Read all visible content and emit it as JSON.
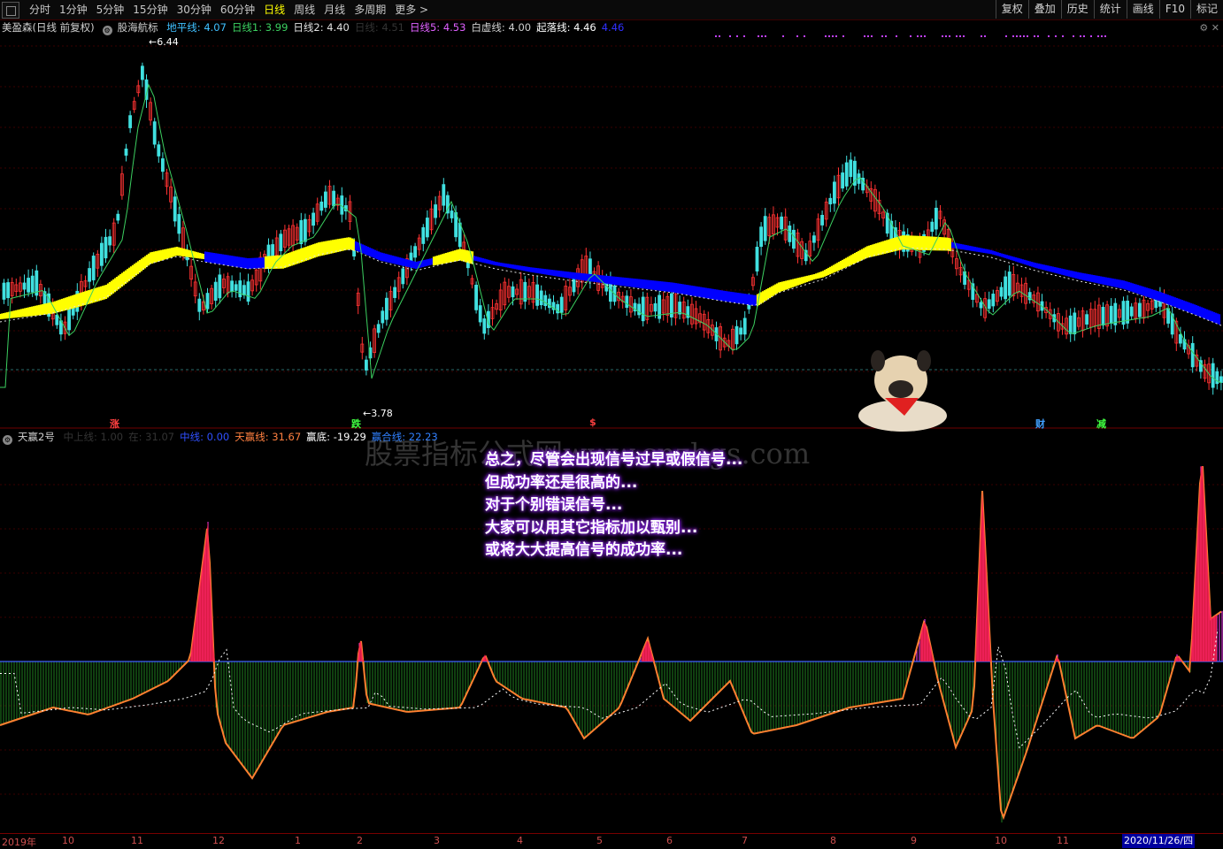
{
  "toolbar": {
    "tabs": [
      "分时",
      "1分钟",
      "5分钟",
      "15分钟",
      "30分钟",
      "60分钟",
      "日线",
      "周线",
      "月线",
      "多周期",
      "更多 >"
    ],
    "active": "日线",
    "right_buttons": [
      "复权",
      "叠加",
      "历史",
      "统计",
      "画线",
      "F10",
      "标记"
    ]
  },
  "main_legend": {
    "stock": "美盈森(日线 前复权)",
    "indicator": "股海航标",
    "items": [
      {
        "label": "地平线",
        "value": "4.07",
        "color": "#40c0ff"
      },
      {
        "label": "日线1",
        "value": "3.99",
        "color": "#3cd060"
      },
      {
        "label": "日线2",
        "value": "4.40",
        "color": "#e0e0e0"
      },
      {
        "label": "日线",
        "value": "4.51",
        "color": "#333333"
      },
      {
        "label": "日线5",
        "value": "4.53",
        "color": "#e060ff"
      },
      {
        "label": "白虚线",
        "value": "4.00",
        "color": "#d0d0d0"
      },
      {
        "label": "起落线",
        "value": "4.46",
        "color": "#ffffff"
      },
      {
        "label": "",
        "value": "4.46",
        "color": "#3030ff"
      }
    ]
  },
  "price_labels": {
    "high": "6.44",
    "low": "3.78"
  },
  "signals": [
    {
      "text": "涨",
      "color": "#ff4040"
    },
    {
      "text": "跌",
      "color": "#40ff40"
    },
    {
      "text": "$",
      "color": "#ff4040"
    },
    {
      "text": "财",
      "color": "#40a0ff"
    },
    {
      "text": "减",
      "color": "#40ff40"
    }
  ],
  "sub_legend": {
    "name": "天赢2号",
    "items": [
      {
        "label": "中上线",
        "value": "1.00",
        "color": "#333333"
      },
      {
        "label": "在",
        "value": "31.07",
        "color": "#333333"
      },
      {
        "label": "中线",
        "value": "0.00",
        "color": "#3050ff"
      },
      {
        "label": "天赢线",
        "value": "31.67",
        "color": "#ff8040"
      },
      {
        "label": "赢底",
        "value": "-19.29",
        "color": "#ffffff"
      },
      {
        "label": "赢合线",
        "value": "22.23",
        "color": "#3080ff"
      }
    ]
  },
  "watermark": "股票指标公式网www.cnzhgs.com",
  "annotation_lines": [
    "总之，尽管会出现信号过早或假信号...",
    "但成功率还是很高的...",
    "对于个别错误信号...",
    "大家可以用其它指标加以甄别...",
    "或将大大提高信号的成功率..."
  ],
  "date_axis": {
    "labels": [
      "2019年",
      "10",
      "11",
      "12",
      "1",
      "2",
      "3",
      "4",
      "5",
      "6",
      "7",
      "8",
      "9",
      "10",
      "11"
    ],
    "selected": "2020/11/26/四"
  },
  "colors": {
    "up": "#ff3232",
    "down": "#40e0e0",
    "band_up": "#ffff00",
    "band_down": "#0000ff",
    "osc_pos": "#ff40ff",
    "osc_neg": "#208020"
  }
}
